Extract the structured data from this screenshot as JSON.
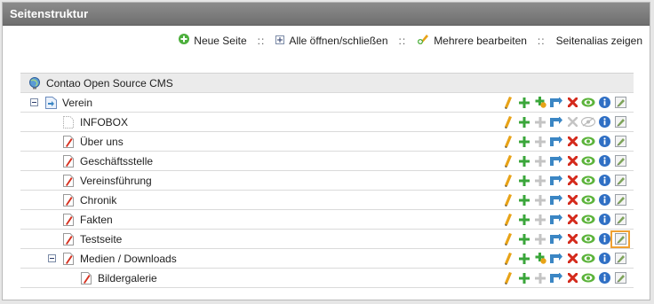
{
  "panel": {
    "title": "Seitenstruktur"
  },
  "toolbar": {
    "new_page": "Neue Seite",
    "toggle_all": "Alle öffnen/schließen",
    "edit_multiple": "Mehrere bearbeiten",
    "page_alias": "Seitenalias zeigen",
    "separator": "::"
  },
  "tree": {
    "root": {
      "label": "Contao Open Source CMS"
    },
    "rows": [
      {
        "label": "Verein",
        "level": 1,
        "toggle": true,
        "icon": "site-root",
        "paste_active": true,
        "visible": true,
        "highlight": false
      },
      {
        "label": "INFOBOX",
        "level": 2,
        "toggle": false,
        "icon": "page-hidden",
        "paste_active": false,
        "visible": false,
        "highlight": false
      },
      {
        "label": "Über uns",
        "level": 2,
        "toggle": false,
        "icon": "page",
        "paste_active": false,
        "visible": true,
        "highlight": false
      },
      {
        "label": "Geschäftsstelle",
        "level": 2,
        "toggle": false,
        "icon": "page",
        "paste_active": false,
        "visible": true,
        "highlight": false
      },
      {
        "label": "Vereinsführung",
        "level": 2,
        "toggle": false,
        "icon": "page",
        "paste_active": false,
        "visible": true,
        "highlight": false
      },
      {
        "label": "Chronik",
        "level": 2,
        "toggle": false,
        "icon": "page",
        "paste_active": false,
        "visible": true,
        "highlight": false
      },
      {
        "label": "Fakten",
        "level": 2,
        "toggle": false,
        "icon": "page",
        "paste_active": false,
        "visible": true,
        "highlight": false
      },
      {
        "label": "Testseite",
        "level": 2,
        "toggle": false,
        "icon": "page",
        "paste_active": false,
        "visible": true,
        "highlight": true
      },
      {
        "label": "Medien / Downloads",
        "level": 2,
        "toggle": true,
        "icon": "page",
        "paste_active": true,
        "visible": true,
        "highlight": false
      },
      {
        "label": "Bildergalerie",
        "level": 3,
        "toggle": false,
        "icon": "page",
        "paste_active": false,
        "visible": true,
        "highlight": false
      }
    ]
  },
  "colors": {
    "header": "#7a7a7a",
    "edit": "#e8a317",
    "add": "#3aa63a",
    "delete": "#d42a1c",
    "visible": "#5bb33a",
    "info": "#2f6fc4",
    "move": "#3b86c4",
    "highlight": "#f0a030"
  }
}
